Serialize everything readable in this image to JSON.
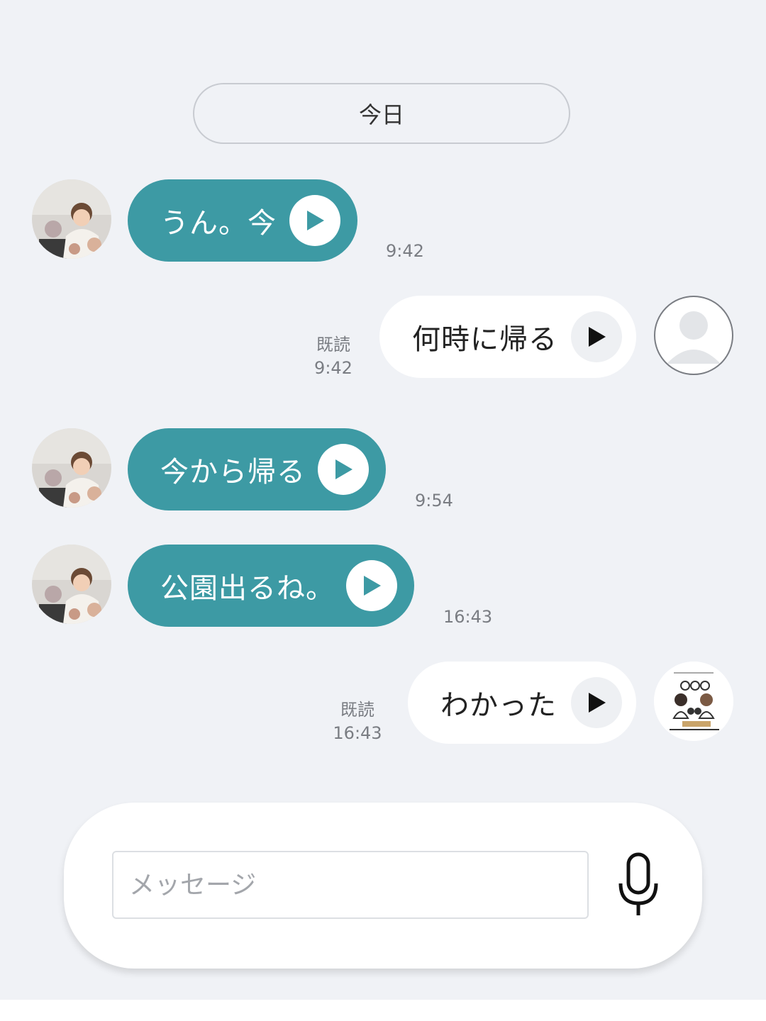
{
  "date_separator": "今日",
  "colors": {
    "background": "#f0f2f6",
    "incoming_bubble": "#3d9aa4",
    "outgoing_bubble": "#ffffff",
    "timestamp": "#7a7d83"
  },
  "messages": [
    {
      "direction": "incoming",
      "text": "うん。今",
      "time": "9:42",
      "icon": "play-icon"
    },
    {
      "direction": "outgoing",
      "text": "何時に帰る",
      "read_label": "既読",
      "time": "9:42",
      "icon": "play-icon"
    },
    {
      "direction": "incoming",
      "text": "今から帰る",
      "time": "9:54",
      "icon": "play-icon"
    },
    {
      "direction": "incoming",
      "text": "公園出るね。",
      "time": "16:43",
      "icon": "play-icon"
    },
    {
      "direction": "outgoing",
      "text": "わかった",
      "read_label": "既読",
      "time": "16:43",
      "icon": "play-icon"
    }
  ],
  "composer": {
    "placeholder": "メッセージ",
    "mic_icon": "microphone-icon"
  }
}
